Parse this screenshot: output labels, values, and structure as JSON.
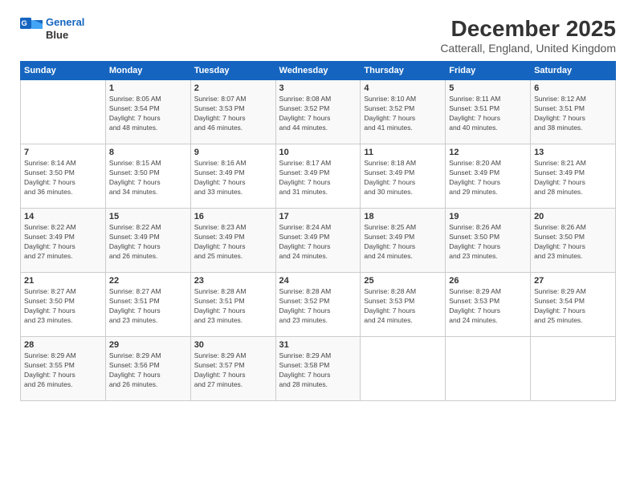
{
  "logo": {
    "line1": "General",
    "line2": "Blue"
  },
  "title": "December 2025",
  "subtitle": "Catterall, England, United Kingdom",
  "days_header": [
    "Sunday",
    "Monday",
    "Tuesday",
    "Wednesday",
    "Thursday",
    "Friday",
    "Saturday"
  ],
  "weeks": [
    [
      {
        "day": "",
        "info": ""
      },
      {
        "day": "1",
        "info": "Sunrise: 8:05 AM\nSunset: 3:54 PM\nDaylight: 7 hours\nand 48 minutes."
      },
      {
        "day": "2",
        "info": "Sunrise: 8:07 AM\nSunset: 3:53 PM\nDaylight: 7 hours\nand 46 minutes."
      },
      {
        "day": "3",
        "info": "Sunrise: 8:08 AM\nSunset: 3:52 PM\nDaylight: 7 hours\nand 44 minutes."
      },
      {
        "day": "4",
        "info": "Sunrise: 8:10 AM\nSunset: 3:52 PM\nDaylight: 7 hours\nand 41 minutes."
      },
      {
        "day": "5",
        "info": "Sunrise: 8:11 AM\nSunset: 3:51 PM\nDaylight: 7 hours\nand 40 minutes."
      },
      {
        "day": "6",
        "info": "Sunrise: 8:12 AM\nSunset: 3:51 PM\nDaylight: 7 hours\nand 38 minutes."
      }
    ],
    [
      {
        "day": "7",
        "info": "Sunrise: 8:14 AM\nSunset: 3:50 PM\nDaylight: 7 hours\nand 36 minutes."
      },
      {
        "day": "8",
        "info": "Sunrise: 8:15 AM\nSunset: 3:50 PM\nDaylight: 7 hours\nand 34 minutes."
      },
      {
        "day": "9",
        "info": "Sunrise: 8:16 AM\nSunset: 3:49 PM\nDaylight: 7 hours\nand 33 minutes."
      },
      {
        "day": "10",
        "info": "Sunrise: 8:17 AM\nSunset: 3:49 PM\nDaylight: 7 hours\nand 31 minutes."
      },
      {
        "day": "11",
        "info": "Sunrise: 8:18 AM\nSunset: 3:49 PM\nDaylight: 7 hours\nand 30 minutes."
      },
      {
        "day": "12",
        "info": "Sunrise: 8:20 AM\nSunset: 3:49 PM\nDaylight: 7 hours\nand 29 minutes."
      },
      {
        "day": "13",
        "info": "Sunrise: 8:21 AM\nSunset: 3:49 PM\nDaylight: 7 hours\nand 28 minutes."
      }
    ],
    [
      {
        "day": "14",
        "info": "Sunrise: 8:22 AM\nSunset: 3:49 PM\nDaylight: 7 hours\nand 27 minutes."
      },
      {
        "day": "15",
        "info": "Sunrise: 8:22 AM\nSunset: 3:49 PM\nDaylight: 7 hours\nand 26 minutes."
      },
      {
        "day": "16",
        "info": "Sunrise: 8:23 AM\nSunset: 3:49 PM\nDaylight: 7 hours\nand 25 minutes."
      },
      {
        "day": "17",
        "info": "Sunrise: 8:24 AM\nSunset: 3:49 PM\nDaylight: 7 hours\nand 24 minutes."
      },
      {
        "day": "18",
        "info": "Sunrise: 8:25 AM\nSunset: 3:49 PM\nDaylight: 7 hours\nand 24 minutes."
      },
      {
        "day": "19",
        "info": "Sunrise: 8:26 AM\nSunset: 3:50 PM\nDaylight: 7 hours\nand 23 minutes."
      },
      {
        "day": "20",
        "info": "Sunrise: 8:26 AM\nSunset: 3:50 PM\nDaylight: 7 hours\nand 23 minutes."
      }
    ],
    [
      {
        "day": "21",
        "info": "Sunrise: 8:27 AM\nSunset: 3:50 PM\nDaylight: 7 hours\nand 23 minutes."
      },
      {
        "day": "22",
        "info": "Sunrise: 8:27 AM\nSunset: 3:51 PM\nDaylight: 7 hours\nand 23 minutes."
      },
      {
        "day": "23",
        "info": "Sunrise: 8:28 AM\nSunset: 3:51 PM\nDaylight: 7 hours\nand 23 minutes."
      },
      {
        "day": "24",
        "info": "Sunrise: 8:28 AM\nSunset: 3:52 PM\nDaylight: 7 hours\nand 23 minutes."
      },
      {
        "day": "25",
        "info": "Sunrise: 8:28 AM\nSunset: 3:53 PM\nDaylight: 7 hours\nand 24 minutes."
      },
      {
        "day": "26",
        "info": "Sunrise: 8:29 AM\nSunset: 3:53 PM\nDaylight: 7 hours\nand 24 minutes."
      },
      {
        "day": "27",
        "info": "Sunrise: 8:29 AM\nSunset: 3:54 PM\nDaylight: 7 hours\nand 25 minutes."
      }
    ],
    [
      {
        "day": "28",
        "info": "Sunrise: 8:29 AM\nSunset: 3:55 PM\nDaylight: 7 hours\nand 26 minutes."
      },
      {
        "day": "29",
        "info": "Sunrise: 8:29 AM\nSunset: 3:56 PM\nDaylight: 7 hours\nand 26 minutes."
      },
      {
        "day": "30",
        "info": "Sunrise: 8:29 AM\nSunset: 3:57 PM\nDaylight: 7 hours\nand 27 minutes."
      },
      {
        "day": "31",
        "info": "Sunrise: 8:29 AM\nSunset: 3:58 PM\nDaylight: 7 hours\nand 28 minutes."
      },
      {
        "day": "",
        "info": ""
      },
      {
        "day": "",
        "info": ""
      },
      {
        "day": "",
        "info": ""
      }
    ]
  ]
}
